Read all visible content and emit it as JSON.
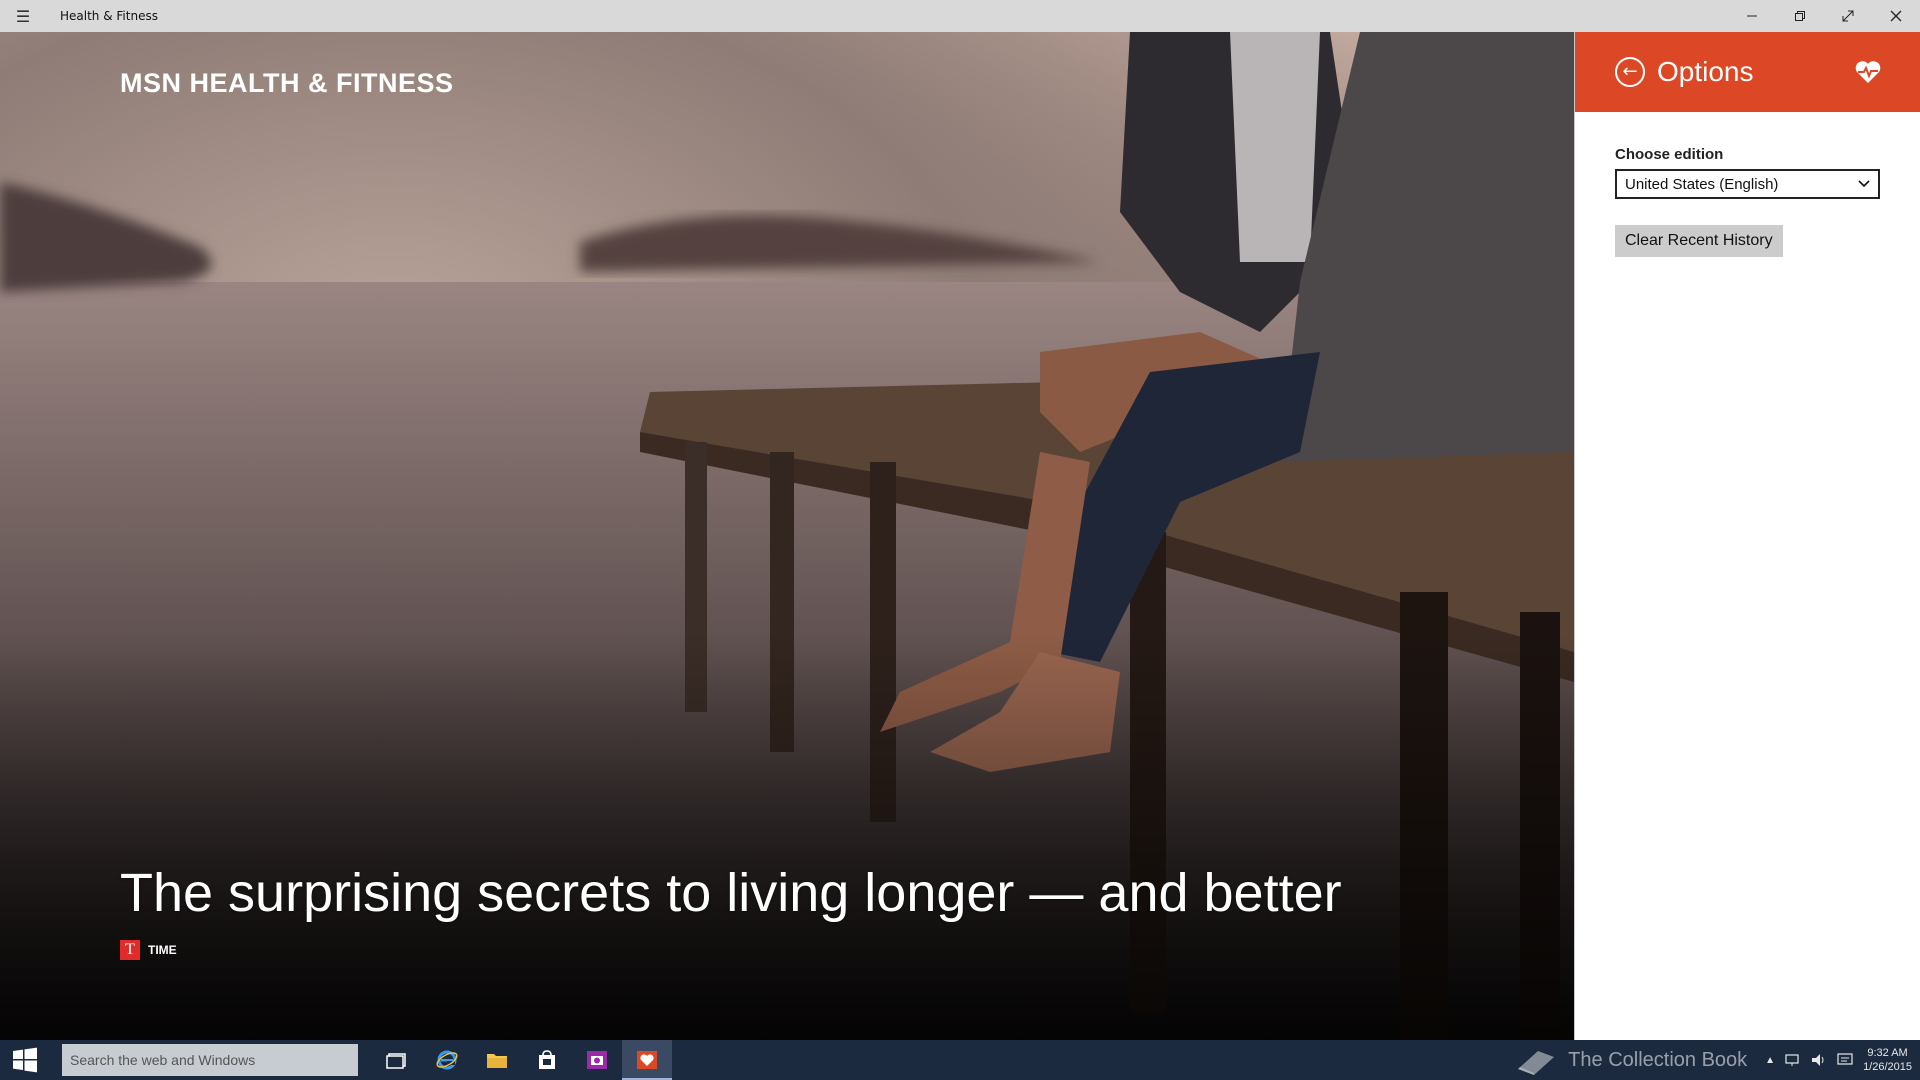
{
  "window": {
    "title": "Health & Fitness",
    "menu_icon": "hamburger-icon",
    "controls": [
      "minimize-icon",
      "restore-icon",
      "fullscreen-icon",
      "close-icon"
    ]
  },
  "hero": {
    "brand": "MSN HEALTH & FITNESS",
    "headline": "The surprising secrets to living longer — and better",
    "source_logo": "T",
    "source_name": "TIME"
  },
  "options": {
    "title": "Options",
    "choose_edition_label": "Choose edition",
    "edition_value": "United States (English)",
    "clear_history_label": "Clear Recent History",
    "header_color": "#dc4726"
  },
  "taskbar": {
    "search_placeholder": "Search the web and Windows",
    "watermark": "The Collection Book",
    "time": "9:32 AM",
    "date": "1/26/2015"
  }
}
